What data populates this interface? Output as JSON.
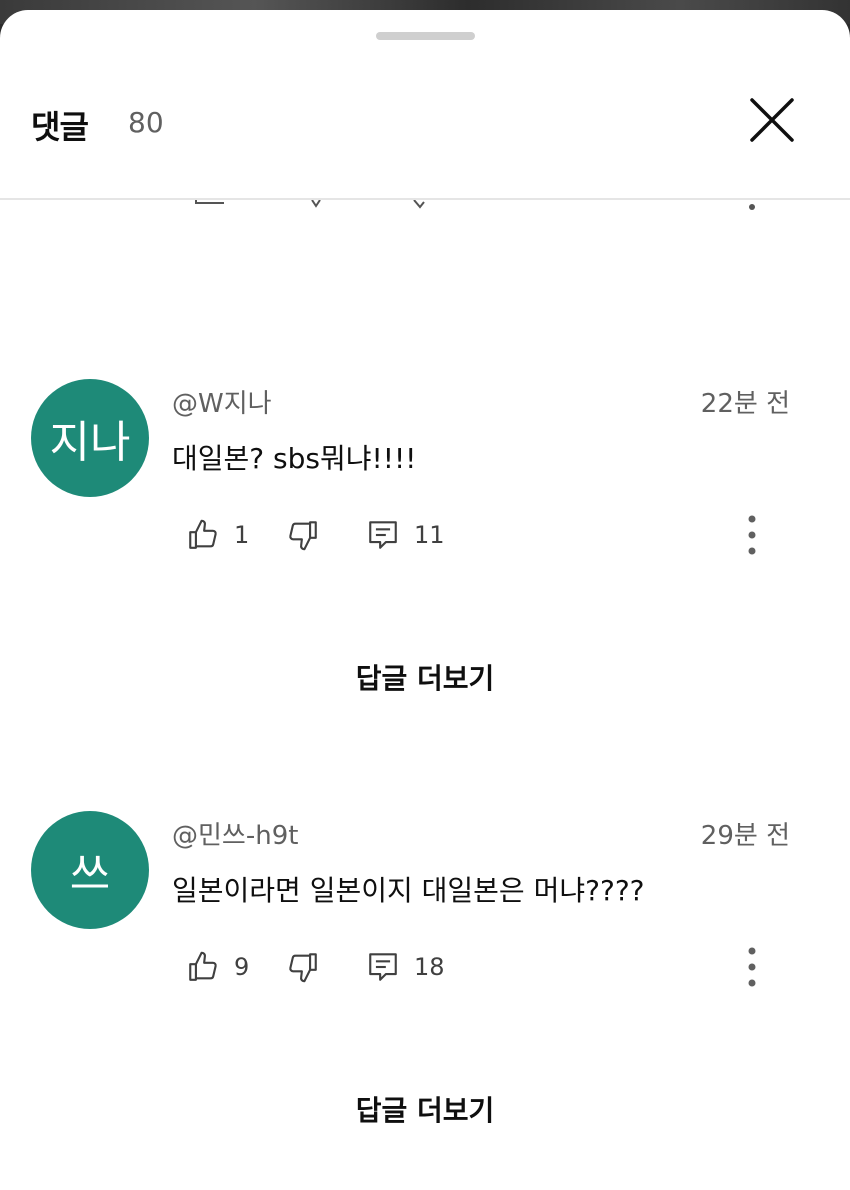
{
  "header": {
    "title": "댓글",
    "count": "80"
  },
  "comments": [
    {
      "avatar_text": "지나",
      "avatar_color": "#1e8a78",
      "handle": "@W지나",
      "time": "22분 전",
      "text": "대일본? sbs뭐냐!!!!",
      "likes": "1",
      "replies": "11",
      "more_replies_label": "답글 더보기"
    },
    {
      "avatar_text": "쓰",
      "avatar_color": "#1e8a78",
      "handle": "@민쓰-h9t",
      "time": "29분 전",
      "text": "일본이라면 일본이지 대일본은 머냐????",
      "likes": "9",
      "replies": "18",
      "more_replies_label": "답글 더보기"
    }
  ],
  "icons": {
    "close": "close-icon",
    "like": "thumbs-up-icon",
    "dislike": "thumbs-down-icon",
    "reply": "reply-icon",
    "more": "more-vert-icon"
  }
}
